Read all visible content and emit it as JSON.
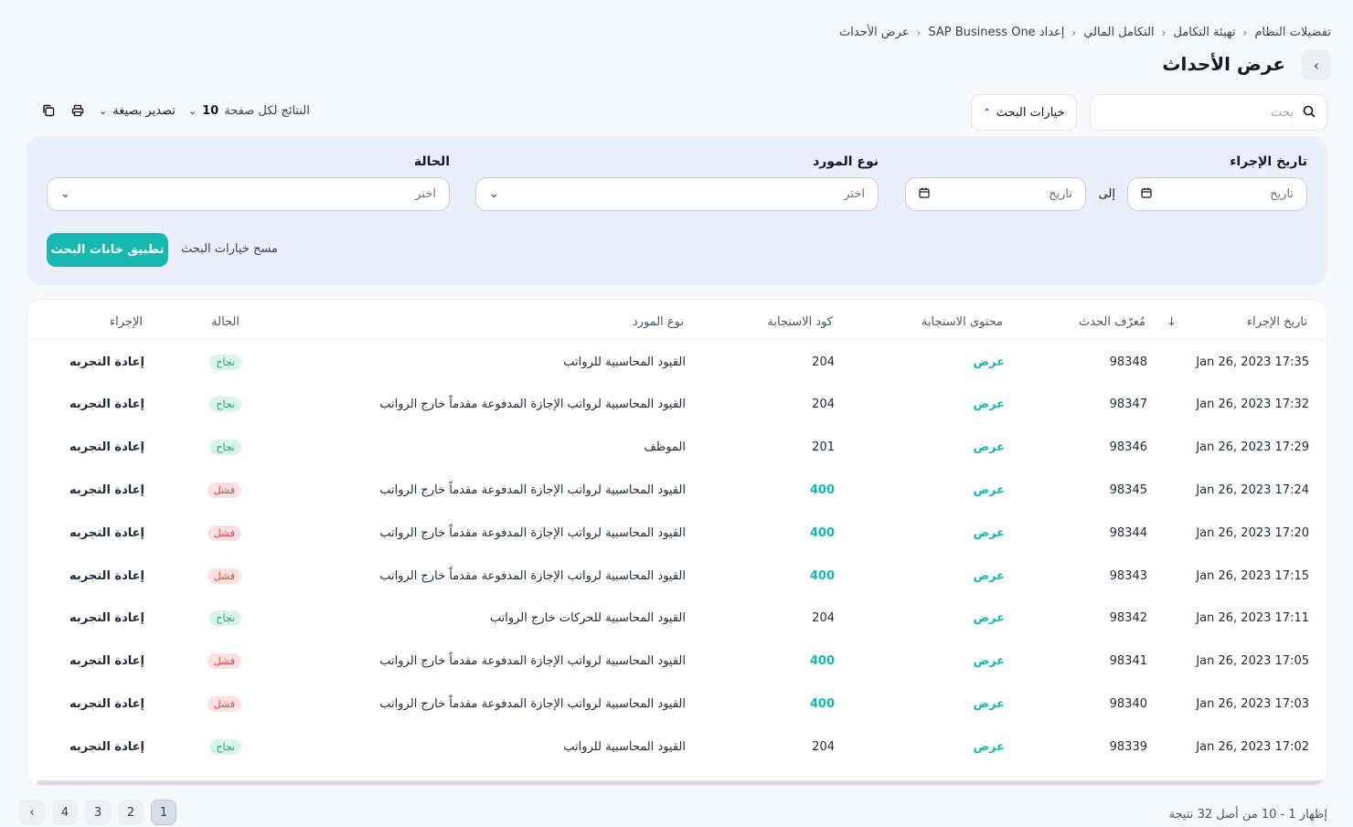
{
  "breadcrumb": [
    "تفضيلات النظام",
    "تهيئة التكامل",
    "التكامل المالي",
    "إعداد SAP Business One",
    "عرض الأحداث"
  ],
  "page_title": "عرض الأحداث",
  "search": {
    "placeholder": "بحث",
    "options_label": "خيارات البحث"
  },
  "toolbar": {
    "export_label": "تصدير بصيغة",
    "per_page_label": "النتائج لكل صفحة",
    "per_page_value": "10"
  },
  "filters": {
    "action_date_label": "تاريخ الإجراء",
    "date_from_placeholder": "تاريخ",
    "to_label": "إلى",
    "date_to_placeholder": "تاريخ",
    "supplier_type_label": "نوع المورد",
    "supplier_type_placeholder": "اختر",
    "status_label": "الحالة",
    "status_placeholder": "اختر",
    "apply_label": "تطبيق خانات البحث",
    "clear_label": "مسح خيارات البحث"
  },
  "table": {
    "columns": {
      "action_date": "تاريخ الإجراء",
      "event_id": "مُعرّف الحدث",
      "response_content": "محتوى الاستجابة",
      "response_code": "كود الاستجابة",
      "supplier_type": "نوع المورد",
      "status": "الحالة",
      "action": "الإجراء"
    },
    "rows": [
      {
        "date": "Jan 26, 2023 17:35",
        "id": "98348",
        "view": "عرض",
        "code": "204",
        "supplier": "القيود المحاسبية للرواتب",
        "status": "نجاح",
        "ok": true,
        "action": "إعادة التجربه"
      },
      {
        "date": "Jan 26, 2023 17:32",
        "id": "98347",
        "view": "عرض",
        "code": "204",
        "supplier": "القيود المحاسبية لرواتب الإجازة المدفوعة مقدماً خارج الرواتب",
        "status": "نجاح",
        "ok": true,
        "action": "إعادة التجربه"
      },
      {
        "date": "Jan 26, 2023 17:29",
        "id": "98346",
        "view": "عرض",
        "code": "201",
        "supplier": "الموظف",
        "status": "نجاح",
        "ok": true,
        "action": "إعادة التجربه"
      },
      {
        "date": "Jan 26, 2023 17:24",
        "id": "98345",
        "view": "عرض",
        "code": "400",
        "supplier": "القيود المحاسبية لرواتب الإجازة المدفوعة مقدماً خارج الرواتب",
        "status": "فشل",
        "ok": false,
        "action": "إعادة التجربه"
      },
      {
        "date": "Jan 26, 2023 17:20",
        "id": "98344",
        "view": "عرض",
        "code": "400",
        "supplier": "القيود المحاسبية لرواتب الإجازة المدفوعة مقدماً خارج الرواتب",
        "status": "فشل",
        "ok": false,
        "action": "إعادة التجربه"
      },
      {
        "date": "Jan 26, 2023 17:15",
        "id": "98343",
        "view": "عرض",
        "code": "400",
        "supplier": "القيود المحاسبية لرواتب الإجازة المدفوعة مقدماً خارج الرواتب",
        "status": "فشل",
        "ok": false,
        "action": "إعادة التجربه"
      },
      {
        "date": "Jan 26, 2023 17:11",
        "id": "98342",
        "view": "عرض",
        "code": "204",
        "supplier": "القيود المحاسبية للحركات خارج الرواتب",
        "status": "نجاح",
        "ok": true,
        "action": "إعادة التجربه"
      },
      {
        "date": "Jan 26, 2023 17:05",
        "id": "98341",
        "view": "عرض",
        "code": "400",
        "supplier": "القيود المحاسبية لرواتب الإجازة المدفوعة مقدماً خارج الرواتب",
        "status": "فشل",
        "ok": false,
        "action": "إعادة التجربه"
      },
      {
        "date": "Jan 26, 2023 17:03",
        "id": "98340",
        "view": "عرض",
        "code": "400",
        "supplier": "القيود المحاسبية لرواتب الإجازة المدفوعة مقدماً خارج الرواتب",
        "status": "فشل",
        "ok": false,
        "action": "إعادة التجربه"
      },
      {
        "date": "Jan 26, 2023 17:02",
        "id": "98339",
        "view": "عرض",
        "code": "204",
        "supplier": "القيود المحاسبية للرواتب",
        "status": "نجاح",
        "ok": true,
        "action": "إعادة التجربه"
      }
    ]
  },
  "pagination": {
    "pages": [
      "1",
      "2",
      "3",
      "4"
    ],
    "current": "1",
    "summary": "إظهار 1 - 10 من أصل 32 نتيجة"
  },
  "colors": {
    "accent": "#16b8b0",
    "success_bg": "#d8f4ec",
    "fail_bg": "#fde1e1",
    "panel": "#eaf0fa"
  }
}
